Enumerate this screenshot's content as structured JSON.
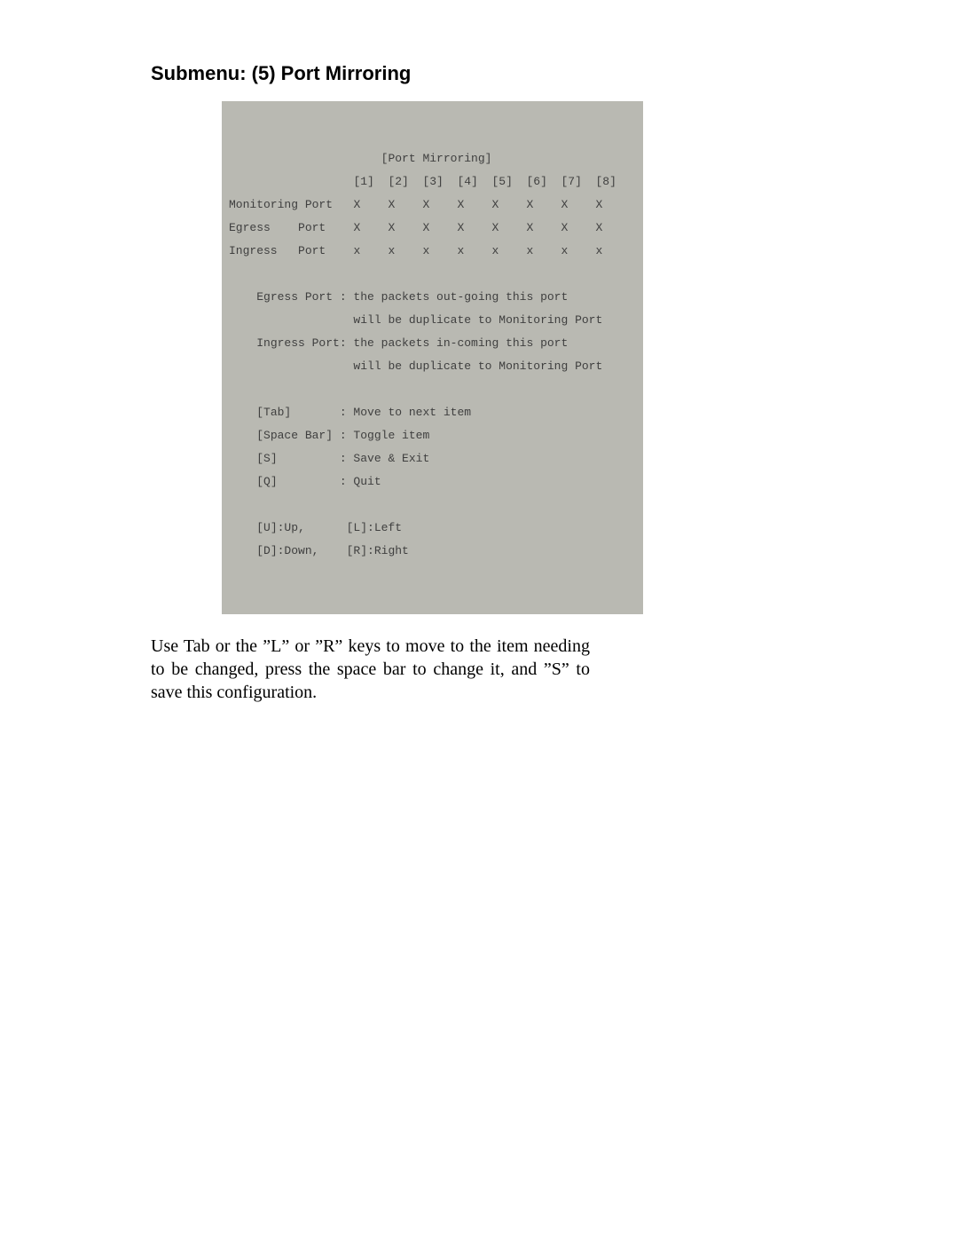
{
  "heading": "Submenu: (5) Port Mirroring",
  "terminal": {
    "title": "[Port Mirroring]",
    "columns": "[1]  [2]  [3]  [4]  [5]  [6]  [7]  [8]",
    "rows": [
      {
        "label": "Monitoring Port",
        "cells": "X    X    X    X    X    X    X    X"
      },
      {
        "label": "Egress    Port",
        "cells": "X    X    X    X    X    X    X    X"
      },
      {
        "label": "Ingress   Port",
        "cells": "x    x    x    x    x    x    x    x"
      }
    ],
    "notes": [
      "Egress Port : the packets out-going this port",
      "              will be duplicate to Monitoring Port",
      "Ingress Port: the packets in-coming this port",
      "              will be duplicate to Monitoring Port"
    ],
    "keys": [
      "[Tab]       : Move to next item",
      "[Space Bar] : Toggle item",
      "[S]         : Save & Exit",
      "[Q]         : Quit"
    ],
    "nav": [
      "[U]:Up,      [L]:Left",
      "[D]:Down,    [R]:Right"
    ]
  },
  "bodyText": "Use Tab or the ”L” or ”R” keys to move to the item needing to be changed, press the space bar to change it, and ”S” to save this configuration."
}
